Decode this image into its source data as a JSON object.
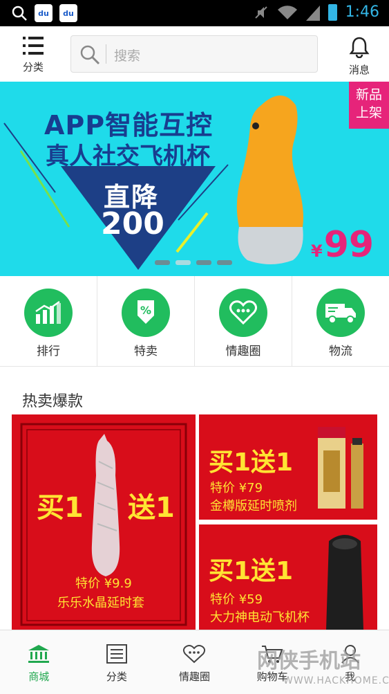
{
  "status_bar": {
    "time": "1:46",
    "left_icons": [
      "search-icon",
      "baidu-icon",
      "baidu-icon"
    ],
    "right_icons": [
      "mute-icon",
      "wifi-icon",
      "signal-icon",
      "battery-icon"
    ]
  },
  "header": {
    "category_label": "分类",
    "search_placeholder": "搜索",
    "message_label": "消息"
  },
  "banner": {
    "headline1": "APP智能互控",
    "headline2": "真人社交飞机杯",
    "drop_label": "直降",
    "drop_amount": "200",
    "badge_line1": "新品",
    "badge_line2": "上架",
    "price_symbol": "¥",
    "price": "99",
    "active_slide": 2,
    "slide_count": 4
  },
  "quick_links": [
    {
      "label": "排行",
      "icon": "bar-chart-icon"
    },
    {
      "label": "特卖",
      "icon": "percent-icon"
    },
    {
      "label": "情趣圈",
      "icon": "chat-heart-icon"
    },
    {
      "label": "物流",
      "icon": "truck-icon"
    }
  ],
  "section": {
    "title": "热卖爆款"
  },
  "products": [
    {
      "promo_a": "买1",
      "promo_b": "送1",
      "price_label": "特价 ¥9.9",
      "name": "乐乐水晶延时套"
    },
    {
      "promo": "买1送1",
      "price_label": "特价 ¥79",
      "name": "金樽版延时喷剂"
    },
    {
      "promo": "买1送1",
      "price_label": "特价 ¥59",
      "name": "大力神电动飞机杯"
    }
  ],
  "bottom_nav": [
    {
      "label": "商城",
      "icon": "bank-icon",
      "active": true
    },
    {
      "label": "分类",
      "icon": "list-icon",
      "active": false
    },
    {
      "label": "情趣圈",
      "icon": "chat-heart-icon",
      "active": false
    },
    {
      "label": "购物车",
      "icon": "cart-icon",
      "active": false
    },
    {
      "label": "我",
      "icon": "user-icon",
      "active": false
    }
  ],
  "watermark": {
    "text": "网侠手机站",
    "url": "WWW.HACKHOME.COM"
  },
  "colors": {
    "accent_green": "#21bd5e",
    "banner_bg": "#1fdbea",
    "promo_red": "#d80d1a",
    "promo_yellow": "#ffe433",
    "pink": "#e6247a"
  }
}
